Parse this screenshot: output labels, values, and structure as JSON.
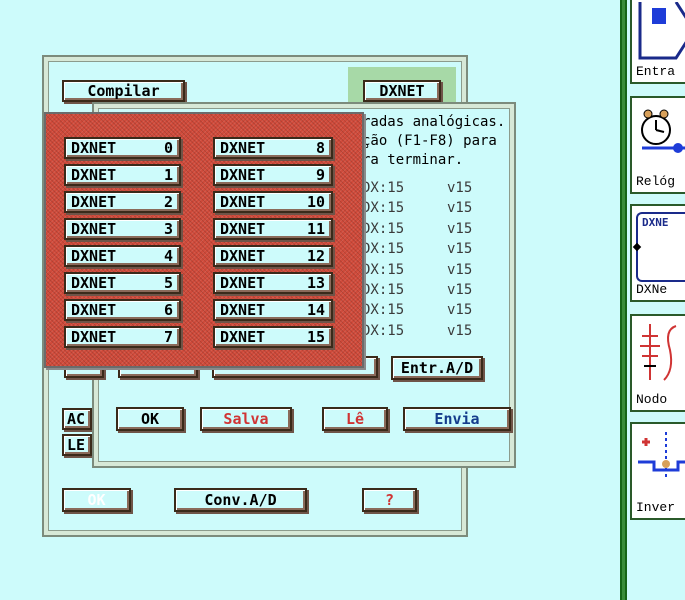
{
  "back_window": {
    "compile_button": "Compilar",
    "dxnet_button": "DXNET",
    "ac_button": "AC",
    "le_button": "LE",
    "ok_button": "OK",
    "conv_button": "Conv.A/D",
    "help_button": "?"
  },
  "dialog": {
    "info_lines": [
      "radas analógicas.",
      "ção (F1-F8) para",
      "ra terminar."
    ],
    "channel_rows": [
      {
        "dx": "DX:15",
        "v": "v15"
      },
      {
        "dx": "DX:15",
        "v": "v15"
      },
      {
        "dx": "DX:15",
        "v": "v15"
      },
      {
        "dx": "DX:15",
        "v": "v15"
      },
      {
        "dx": "DX:15",
        "v": "v15"
      },
      {
        "dx": "DX:15",
        "v": "v15"
      },
      {
        "dx": "DX:15",
        "v": "v15"
      },
      {
        "dx": "DX:15",
        "v": "v15"
      }
    ],
    "entr_button": "Entr.A/D",
    "ok_button": "OK",
    "salva_button": "Salva",
    "le_button": "Lê",
    "envia_button": "Envia"
  },
  "dxnet_list": {
    "left": [
      {
        "label": "DXNET",
        "num": "0"
      },
      {
        "label": "DXNET",
        "num": "1"
      },
      {
        "label": "DXNET",
        "num": "2"
      },
      {
        "label": "DXNET",
        "num": "3"
      },
      {
        "label": "DXNET",
        "num": "4"
      },
      {
        "label": "DXNET",
        "num": "5"
      },
      {
        "label": "DXNET",
        "num": "6"
      },
      {
        "label": "DXNET",
        "num": "7"
      }
    ],
    "right": [
      {
        "label": "DXNET",
        "num": "8"
      },
      {
        "label": "DXNET",
        "num": "9"
      },
      {
        "label": "DXNET",
        "num": "10"
      },
      {
        "label": "DXNET",
        "num": "11"
      },
      {
        "label": "DXNET",
        "num": "12"
      },
      {
        "label": "DXNET",
        "num": "13"
      },
      {
        "label": "DXNET",
        "num": "14"
      },
      {
        "label": "DXNET",
        "num": "15"
      }
    ]
  },
  "palette": {
    "items": [
      {
        "label": "Entra",
        "icon": "input-block-icon"
      },
      {
        "label": "Relóg",
        "icon": "clock-icon"
      },
      {
        "label": "DXNe",
        "icon": "dxnet-module-icon"
      },
      {
        "label": "Nodo",
        "icon": "node-function-icon"
      },
      {
        "label": "Inver",
        "icon": "inverter-icon"
      }
    ],
    "dxnet_icon_text": "DXNE"
  }
}
